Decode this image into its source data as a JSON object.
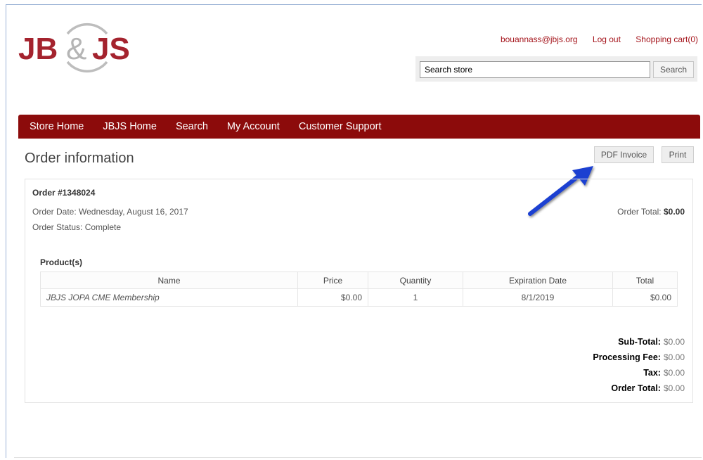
{
  "logo": {
    "text": "JB&JS",
    "brand_color": "#a4232e",
    "accent_color": "#b8b8b8"
  },
  "header": {
    "links": [
      {
        "label": "bouannass@jbjs.org"
      },
      {
        "label": "Log out"
      },
      {
        "label": "Shopping cart(0)"
      }
    ],
    "search": {
      "value": "Search store",
      "button_label": "Search"
    }
  },
  "nav": {
    "items": [
      "Store Home",
      "JBJS Home",
      "Search",
      "My Account",
      "Customer Support"
    ],
    "color": "#8c0b0b"
  },
  "page": {
    "title": "Order information",
    "pdf_button": "PDF Invoice",
    "print_button": "Print"
  },
  "order": {
    "number": "Order #1348024",
    "date": "Order Date: Wednesday, August 16, 2017",
    "status": "Order Status: Complete",
    "total_label": "Order Total:",
    "total_value": "$0.00"
  },
  "products": {
    "label": "Product(s)",
    "columns": [
      "Name",
      "Price",
      "Quantity",
      "Expiration Date",
      "Total"
    ],
    "rows": [
      {
        "name": "JBJS JOPA CME Membership",
        "price": "$0.00",
        "quantity": "1",
        "expiration": "8/1/2019",
        "total": "$0.00"
      }
    ]
  },
  "totals": [
    {
      "label": "Sub-Total:",
      "value": "$0.00"
    },
    {
      "label": "Processing Fee:",
      "value": "$0.00"
    },
    {
      "label": "Tax:",
      "value": "$0.00"
    },
    {
      "label": "Order Total:",
      "value": "$0.00"
    }
  ],
  "annotation": {
    "arrow_color": "#1a3fd1"
  }
}
